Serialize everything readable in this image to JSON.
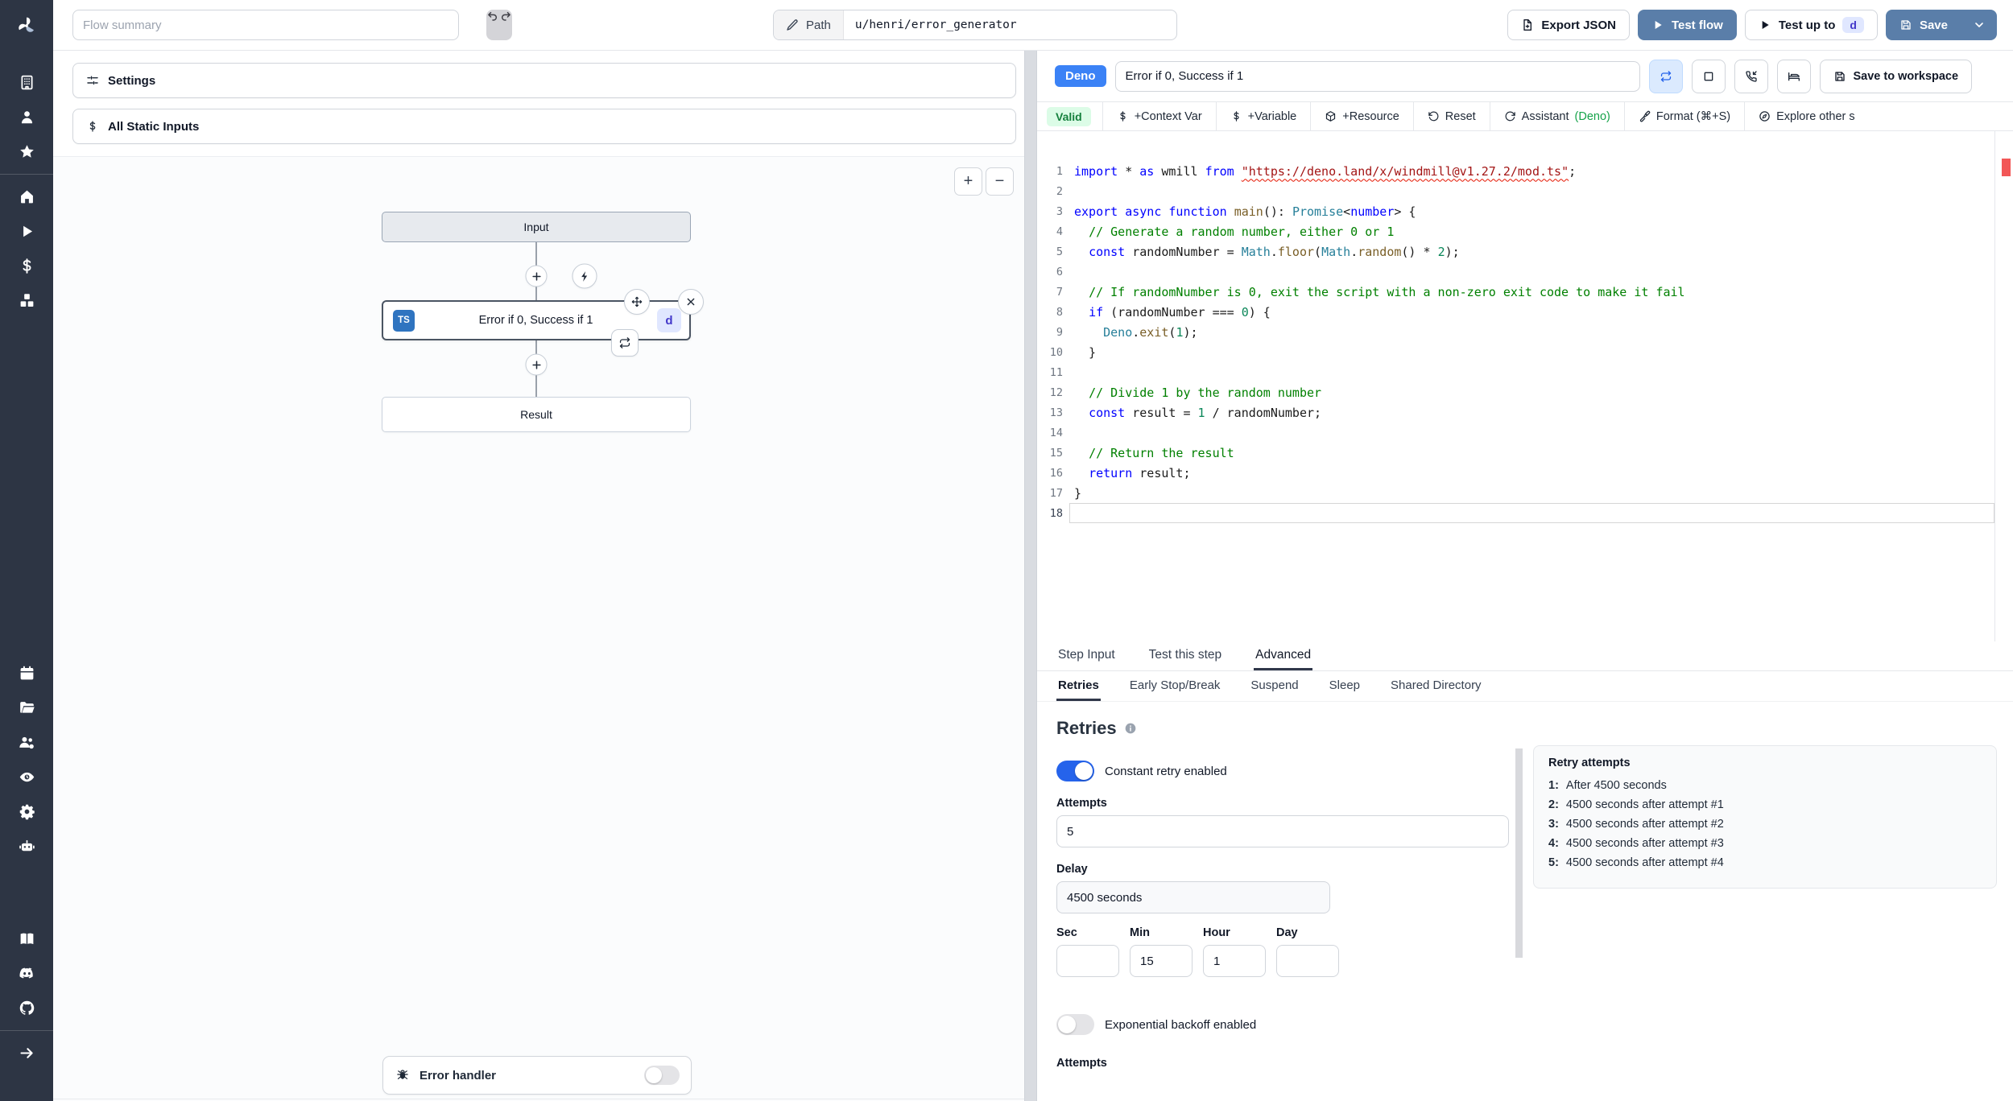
{
  "topbar": {
    "flow_summary_placeholder": "Flow summary",
    "path_label": "Path",
    "path_value": "u/henri/error_generator",
    "export_json_label": "Export JSON",
    "test_flow_label": "Test flow",
    "test_up_to_label": "Test up to",
    "test_up_to_step": "d",
    "save_label": "Save"
  },
  "sidebar": {
    "items": [
      {
        "type": "icon",
        "name": "building"
      },
      {
        "type": "icon",
        "name": "user"
      },
      {
        "type": "icon",
        "name": "star"
      },
      {
        "type": "divider"
      },
      {
        "type": "icon",
        "name": "home"
      },
      {
        "type": "icon",
        "name": "play"
      },
      {
        "type": "icon",
        "name": "dollar"
      },
      {
        "type": "icon",
        "name": "boxes"
      },
      {
        "type": "spacer"
      },
      {
        "type": "icon",
        "name": "calendar"
      },
      {
        "type": "icon",
        "name": "folder"
      },
      {
        "type": "icon",
        "name": "users"
      },
      {
        "type": "icon",
        "name": "eye"
      },
      {
        "type": "icon",
        "name": "gear"
      },
      {
        "type": "icon",
        "name": "bot"
      },
      {
        "type": "gap"
      },
      {
        "type": "icon",
        "name": "book"
      },
      {
        "type": "icon",
        "name": "discord"
      },
      {
        "type": "icon",
        "name": "github"
      },
      {
        "type": "divider"
      },
      {
        "type": "icon",
        "name": "arrow-right"
      },
      {
        "type": "bottom-pad"
      }
    ]
  },
  "flow_panel": {
    "settings_label": "Settings",
    "static_inputs_label": "All Static Inputs",
    "zoom_in": "+",
    "zoom_out": "−",
    "nodes": {
      "input": "Input",
      "module_title": "Error if 0, Success if 1",
      "module_lang": "TS",
      "module_id": "d",
      "result": "Result"
    },
    "error_handler_label": "Error handler"
  },
  "editor": {
    "lang_badge": "Deno",
    "step_name": "Error if 0, Success if 1",
    "save_to_workspace_label": "Save to workspace",
    "toolbar": {
      "valid_badge": "Valid",
      "buttons": [
        {
          "icon": "dollar-d",
          "label": "+Context Var"
        },
        {
          "icon": "dollar-d",
          "label": "+Variable"
        },
        {
          "icon": "package",
          "label": "+Resource"
        },
        {
          "icon": "rotate-ccw",
          "label": "Reset"
        },
        {
          "icon": "refresh",
          "label": "Assistant",
          "suffix": "(Deno)"
        },
        {
          "icon": "brush",
          "label": "Format (⌘+S)"
        },
        {
          "icon": "compass",
          "label": "Explore other s"
        }
      ]
    },
    "code": {
      "active_line": 18,
      "lines": [
        [
          [
            "k",
            "import"
          ],
          [
            "p",
            " * "
          ],
          [
            "k",
            "as"
          ],
          [
            "p",
            " wmill "
          ],
          [
            "k",
            "from"
          ],
          [
            "p",
            " "
          ],
          [
            "s",
            "\"https://deno.land/x/windmill@v1.27.2/mod.ts\""
          ],
          [
            "p",
            ";"
          ]
        ],
        [],
        [
          [
            "k",
            "export"
          ],
          [
            "p",
            " "
          ],
          [
            "k",
            "async"
          ],
          [
            "p",
            " "
          ],
          [
            "k",
            "function"
          ],
          [
            "p",
            " "
          ],
          [
            "f",
            "main"
          ],
          [
            "p",
            "(): "
          ],
          [
            "t",
            "Promise"
          ],
          [
            "p",
            "<"
          ],
          [
            "k",
            "number"
          ],
          [
            "p",
            "> {"
          ]
        ],
        [
          [
            "p",
            "  "
          ],
          [
            "c",
            "// Generate a random number, either 0 or 1"
          ]
        ],
        [
          [
            "p",
            "  "
          ],
          [
            "k",
            "const"
          ],
          [
            "p",
            " randomNumber = "
          ],
          [
            "t",
            "Math"
          ],
          [
            "p",
            "."
          ],
          [
            "f",
            "floor"
          ],
          [
            "p",
            "("
          ],
          [
            "t",
            "Math"
          ],
          [
            "p",
            "."
          ],
          [
            "f",
            "random"
          ],
          [
            "p",
            "() * "
          ],
          [
            "n",
            "2"
          ],
          [
            "p",
            ");"
          ]
        ],
        [],
        [
          [
            "p",
            "  "
          ],
          [
            "c",
            "// If randomNumber is 0, exit the script with a non-zero exit code to make it fail"
          ]
        ],
        [
          [
            "p",
            "  "
          ],
          [
            "k",
            "if"
          ],
          [
            "p",
            " (randomNumber === "
          ],
          [
            "n",
            "0"
          ],
          [
            "p",
            ") {"
          ]
        ],
        [
          [
            "p",
            "    "
          ],
          [
            "t",
            "Deno"
          ],
          [
            "p",
            "."
          ],
          [
            "f",
            "exit"
          ],
          [
            "p",
            "("
          ],
          [
            "n",
            "1"
          ],
          [
            "p",
            ");"
          ]
        ],
        [
          [
            "p",
            "  }"
          ]
        ],
        [],
        [
          [
            "p",
            "  "
          ],
          [
            "c",
            "// Divide 1 by the random number"
          ]
        ],
        [
          [
            "p",
            "  "
          ],
          [
            "k",
            "const"
          ],
          [
            "p",
            " result = "
          ],
          [
            "n",
            "1"
          ],
          [
            "p",
            " / randomNumber;"
          ]
        ],
        [],
        [
          [
            "p",
            "  "
          ],
          [
            "c",
            "// Return the result"
          ]
        ],
        [
          [
            "p",
            "  "
          ],
          [
            "k",
            "return"
          ],
          [
            "p",
            " result;"
          ]
        ],
        [
          [
            "p",
            "}"
          ]
        ],
        []
      ]
    }
  },
  "tabs": {
    "items": [
      "Step Input",
      "Test this step",
      "Advanced"
    ],
    "active_index": 2
  },
  "subtabs": {
    "items": [
      "Retries",
      "Early Stop/Break",
      "Suspend",
      "Sleep",
      "Shared Directory"
    ],
    "active_index": 0
  },
  "retries": {
    "title": "Retries",
    "constant_label": "Constant retry enabled",
    "constant_enabled": true,
    "attempts_label": "Attempts",
    "attempts_value": "5",
    "delay_label": "Delay",
    "delay_value": "4500 seconds",
    "time_fields": [
      {
        "label": "Sec",
        "value": ""
      },
      {
        "label": "Min",
        "value": "15"
      },
      {
        "label": "Hour",
        "value": "1"
      },
      {
        "label": "Day",
        "value": ""
      }
    ],
    "exponential_label": "Exponential backoff enabled",
    "exponential_enabled": false,
    "next_section_label": "Attempts",
    "preview": {
      "title": "Retry attempts",
      "items": [
        {
          "n": "1:",
          "text": "After 4500 seconds"
        },
        {
          "n": "2:",
          "text": "4500 seconds after attempt #1"
        },
        {
          "n": "3:",
          "text": "4500 seconds after attempt #2"
        },
        {
          "n": "4:",
          "text": "4500 seconds after attempt #3"
        },
        {
          "n": "5:",
          "text": "4500 seconds after attempt #4"
        }
      ]
    }
  },
  "colors": {
    "primary_button": "#5a7ea9",
    "deno_badge": "#3b82f6",
    "valid_bg": "#dcfce7",
    "valid_text": "#15803d",
    "toggle_on": "#2563eb",
    "sidebar_bg": "#2d3544",
    "step_badge_bg": "#e0e7ff",
    "step_badge_text": "#4338ca"
  }
}
